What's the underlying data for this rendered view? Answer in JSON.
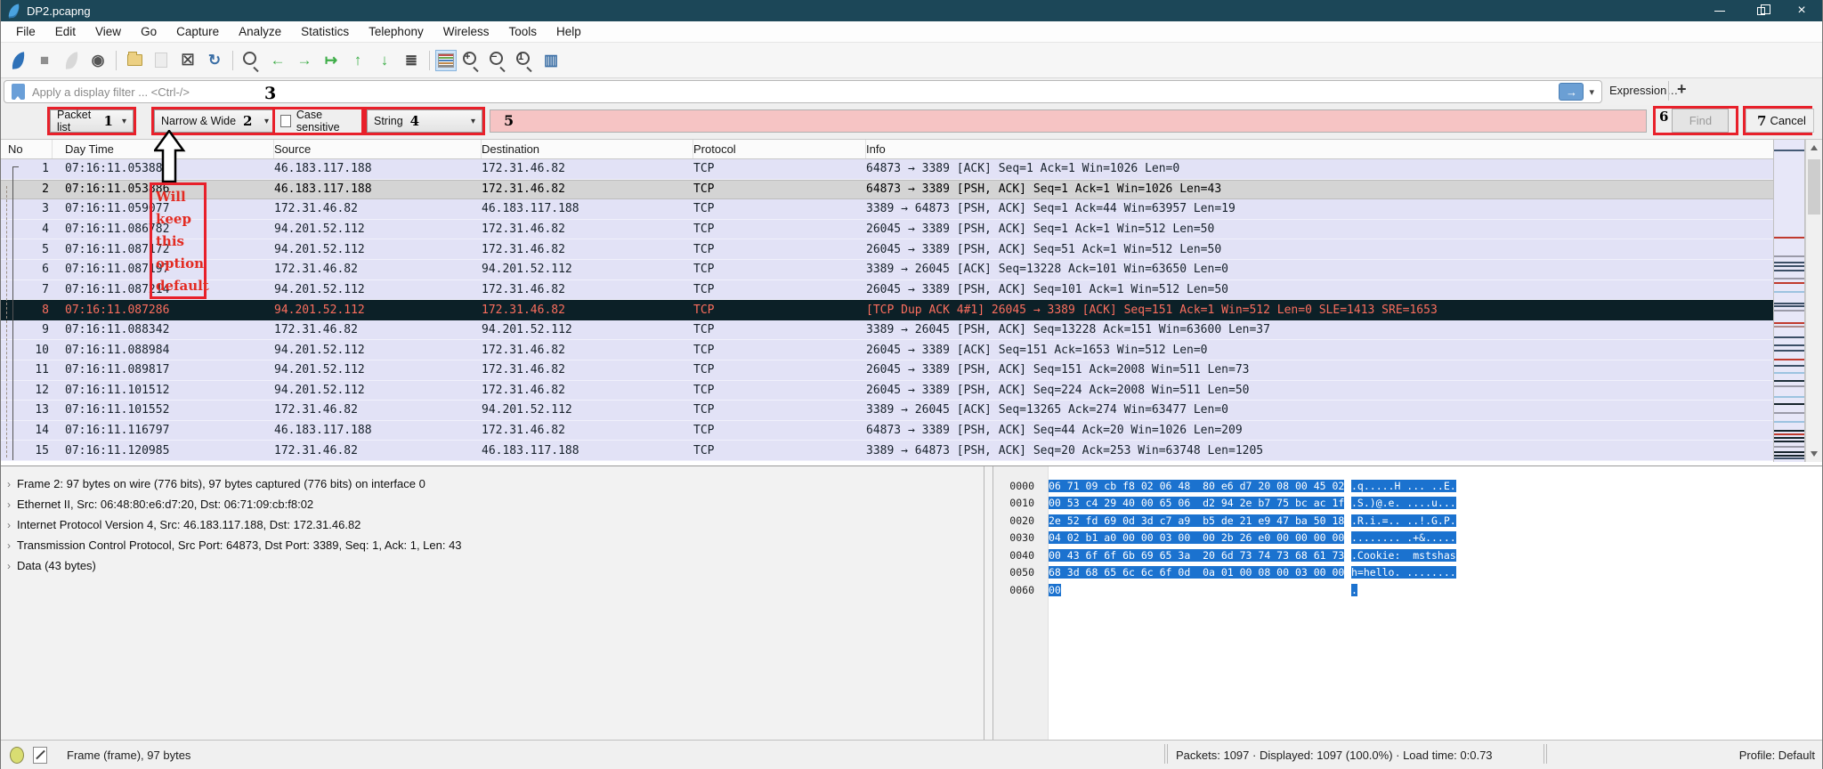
{
  "window": {
    "title": "DP2.pcapng"
  },
  "titlebar": {
    "close_glyph": "×"
  },
  "menu": {
    "items": [
      "File",
      "Edit",
      "View",
      "Go",
      "Capture",
      "Analyze",
      "Statistics",
      "Telephony",
      "Wireless",
      "Tools",
      "Help"
    ]
  },
  "toolbar": {
    "icons": [
      {
        "name": "start-capture",
        "cls": "fin",
        "color": "#2e71b8"
      },
      {
        "name": "stop-capture",
        "char": "■",
        "color": "#8f8f8f"
      },
      {
        "name": "restart-capture",
        "cls": "fin",
        "color": "#b0b0b0",
        "disabled": true
      },
      {
        "name": "capture-options",
        "char": "◉",
        "color": "#555555"
      },
      {
        "sep": true
      },
      {
        "name": "open-file",
        "cls": "folder"
      },
      {
        "name": "save-file",
        "cls": "doc",
        "disabled": true
      },
      {
        "name": "close-file",
        "char": "☒",
        "color": "#444444"
      },
      {
        "name": "reload-file",
        "char": "↻",
        "color": "#3a6ea5"
      },
      {
        "sep": true
      },
      {
        "name": "find-packet",
        "cls": "mag"
      },
      {
        "name": "go-back",
        "char": "←",
        "color": "#3fae49"
      },
      {
        "name": "go-forward",
        "char": "→",
        "color": "#3fae49"
      },
      {
        "name": "go-to-packet",
        "char": "↦",
        "color": "#3fae49"
      },
      {
        "name": "go-to-top",
        "char": "↑",
        "color": "#3fae49"
      },
      {
        "name": "go-to-bottom",
        "char": "↓",
        "color": "#3fae49"
      },
      {
        "name": "auto-scroll",
        "char": "≣",
        "color": "#444444"
      },
      {
        "sep": true
      },
      {
        "name": "colorize-packets",
        "cls": "colorize",
        "selected": true
      },
      {
        "name": "zoom-in",
        "cls": "mag",
        "char": "+"
      },
      {
        "name": "zoom-out",
        "cls": "mag",
        "char": "−"
      },
      {
        "name": "zoom-reset",
        "cls": "mag",
        "char": "1"
      },
      {
        "name": "resize-columns",
        "char": "▥",
        "color": "#3a6ea5"
      }
    ]
  },
  "filter_bar": {
    "placeholder": "Apply a display filter ... <Ctrl-/>",
    "apply_arrow": "→",
    "caret": "▾",
    "expression_label": "Expression…",
    "add_label": "+"
  },
  "find_bar": {
    "scope": "Packet list",
    "charset": "Narrow & Wide",
    "case_label": "Case sensitive",
    "type": "String",
    "search_value": "",
    "find_label": "Find",
    "cancel_label": "Cancel",
    "caret": "▾"
  },
  "annotations": {
    "numbers": [
      "1",
      "2",
      "3",
      "4",
      "5",
      "6",
      "7"
    ],
    "note_lines": [
      "Will",
      "keep",
      "this",
      "option",
      "default"
    ],
    "accent": "#e8202a"
  },
  "packet_list": {
    "columns": [
      "No",
      "Day Time",
      "Source",
      "Destination",
      "Protocol",
      "Info"
    ],
    "rows": [
      {
        "no": "1",
        "time": "07:16:11.053886",
        "src": "46.183.117.188",
        "dst": "172.31.46.82",
        "proto": "TCP",
        "info": "64873 → 3389 [ACK] Seq=1 Ack=1 Win=1026 Len=0",
        "state": "normal"
      },
      {
        "no": "2",
        "time": "07:16:11.053886",
        "src": "46.183.117.188",
        "dst": "172.31.46.82",
        "proto": "TCP",
        "info": "64873 → 3389 [PSH, ACK] Seq=1 Ack=1 Win=1026 Len=43",
        "state": "selected"
      },
      {
        "no": "3",
        "time": "07:16:11.059077",
        "src": "172.31.46.82",
        "dst": "46.183.117.188",
        "proto": "TCP",
        "info": "3389 → 64873 [PSH, ACK] Seq=1 Ack=44 Win=63957 Len=19",
        "state": "normal"
      },
      {
        "no": "4",
        "time": "07:16:11.086782",
        "src": "94.201.52.112",
        "dst": "172.31.46.82",
        "proto": "TCP",
        "info": "26045 → 3389 [PSH, ACK] Seq=1 Ack=1 Win=512 Len=50",
        "state": "normal"
      },
      {
        "no": "5",
        "time": "07:16:11.087172",
        "src": "94.201.52.112",
        "dst": "172.31.46.82",
        "proto": "TCP",
        "info": "26045 → 3389 [PSH, ACK] Seq=51 Ack=1 Win=512 Len=50",
        "state": "normal"
      },
      {
        "no": "6",
        "time": "07:16:11.087197",
        "src": "172.31.46.82",
        "dst": "94.201.52.112",
        "proto": "TCP",
        "info": "3389 → 26045 [ACK] Seq=13228 Ack=101 Win=63650 Len=0",
        "state": "normal"
      },
      {
        "no": "7",
        "time": "07:16:11.087214",
        "src": "94.201.52.112",
        "dst": "172.31.46.82",
        "proto": "TCP",
        "info": "26045 → 3389 [PSH, ACK] Seq=101 Ack=1 Win=512 Len=50",
        "state": "normal"
      },
      {
        "no": "8",
        "time": "07:16:11.087286",
        "src": "94.201.52.112",
        "dst": "172.31.46.82",
        "proto": "TCP",
        "info": "[TCP Dup ACK 4#1] 26045 → 3389 [ACK] Seq=151 Ack=1 Win=512 Len=0 SLE=1413 SRE=1653",
        "state": "bad"
      },
      {
        "no": "9",
        "time": "07:16:11.088342",
        "src": "172.31.46.82",
        "dst": "94.201.52.112",
        "proto": "TCP",
        "info": "3389 → 26045 [PSH, ACK] Seq=13228 Ack=151 Win=63600 Len=37",
        "state": "normal"
      },
      {
        "no": "10",
        "time": "07:16:11.088984",
        "src": "94.201.52.112",
        "dst": "172.31.46.82",
        "proto": "TCP",
        "info": "26045 → 3389 [ACK] Seq=151 Ack=1653 Win=512 Len=0",
        "state": "normal"
      },
      {
        "no": "11",
        "time": "07:16:11.089817",
        "src": "94.201.52.112",
        "dst": "172.31.46.82",
        "proto": "TCP",
        "info": "26045 → 3389 [PSH, ACK] Seq=151 Ack=2008 Win=511 Len=73",
        "state": "normal"
      },
      {
        "no": "12",
        "time": "07:16:11.101512",
        "src": "94.201.52.112",
        "dst": "172.31.46.82",
        "proto": "TCP",
        "info": "26045 → 3389 [PSH, ACK] Seq=224 Ack=2008 Win=511 Len=50",
        "state": "normal"
      },
      {
        "no": "13",
        "time": "07:16:11.101552",
        "src": "172.31.46.82",
        "dst": "94.201.52.112",
        "proto": "TCP",
        "info": "3389 → 26045 [ACK] Seq=13265 Ack=274 Win=63477 Len=0",
        "state": "normal"
      },
      {
        "no": "14",
        "time": "07:16:11.116797",
        "src": "46.183.117.188",
        "dst": "172.31.46.82",
        "proto": "TCP",
        "info": "64873 → 3389 [PSH, ACK] Seq=44 Ack=20 Win=1026 Len=209",
        "state": "normal"
      },
      {
        "no": "15",
        "time": "07:16:11.120985",
        "src": "172.31.46.82",
        "dst": "46.183.117.188",
        "proto": "TCP",
        "info": "3389 → 64873 [PSH, ACK] Seq=20 Ack=253 Win=63748 Len=1205",
        "state": "normal"
      }
    ]
  },
  "details": {
    "expander": "›",
    "lines": [
      "Frame 2: 97 bytes on wire (776 bits), 97 bytes captured (776 bits) on interface 0",
      "Ethernet II, Src: 06:48:80:e6:d7:20, Dst: 06:71:09:cb:f8:02",
      "Internet Protocol Version 4, Src: 46.183.117.188, Dst: 172.31.46.82",
      "Transmission Control Protocol, Src Port: 64873, Dst Port: 3389, Seq: 1, Ack: 1, Len: 43",
      "Data (43 bytes)"
    ]
  },
  "bytes": {
    "rows": [
      {
        "offset": "0000",
        "hex": "06 71 09 cb f8 02 06 48  80 e6 d7 20 08 00 45 02",
        "ascii": ".q.....H ... ..E."
      },
      {
        "offset": "0010",
        "hex": "00 53 c4 29 40 00 65 06  d2 94 2e b7 75 bc ac 1f",
        "ascii": ".S.)@.e. ....u..."
      },
      {
        "offset": "0020",
        "hex": "2e 52 fd 69 0d 3d c7 a9  b5 de 21 e9 47 ba 50 18",
        "ascii": ".R.i.=.. ..!.G.P."
      },
      {
        "offset": "0030",
        "hex": "04 02 b1 a0 00 00 03 00  00 2b 26 e0 00 00 00 00",
        "ascii": "........ .+&....."
      },
      {
        "offset": "0040",
        "hex": "00 43 6f 6f 6b 69 65 3a  20 6d 73 74 73 68 61 73",
        "ascii": ".Cookie:  mstshas"
      },
      {
        "offset": "0050",
        "hex": "68 3d 68 65 6c 6c 6f 0d  0a 01 00 08 00 03 00 00",
        "ascii": "h=hello. ........"
      },
      {
        "offset": "0060",
        "hex": "00",
        "ascii": "."
      }
    ]
  },
  "status_bar": {
    "left": "Frame (frame), 97 bytes",
    "packets": "Packets: 1097 · Displayed: 1097 (100.0%) ·  Load time: 0:0.73",
    "profile": "Profile: Default"
  },
  "minimap": {
    "stripes": [
      {
        "t": 11,
        "c": "#445a75"
      },
      {
        "t": 109,
        "c": "#c03a2e"
      },
      {
        "t": 130,
        "c": "#9a9aa8"
      },
      {
        "t": 137,
        "c": "#3c4f66"
      },
      {
        "t": 141,
        "c": "#3c4f66"
      },
      {
        "t": 146,
        "c": "#3c4f66"
      },
      {
        "t": 155,
        "c": "#9a9aa8"
      },
      {
        "t": 160,
        "c": "#c03a2e"
      },
      {
        "t": 170,
        "c": "#9cc3e0"
      },
      {
        "t": 183,
        "c": "#3c4f66"
      },
      {
        "t": 186,
        "c": "#3c4f66"
      },
      {
        "t": 191,
        "c": "#9a9aa8"
      },
      {
        "t": 205,
        "c": "#c03a2e"
      },
      {
        "t": 209,
        "c": "#b08a8a"
      },
      {
        "t": 221,
        "c": "#3c4f66"
      },
      {
        "t": 230,
        "c": "#3c4f66"
      },
      {
        "t": 236,
        "c": "#3c4f66"
      },
      {
        "t": 246,
        "c": "#c03a2e"
      },
      {
        "t": 253,
        "c": "#3c4f66"
      },
      {
        "t": 261,
        "c": "#9cc3e0"
      },
      {
        "t": 270,
        "c": "#1d2e38"
      },
      {
        "t": 276,
        "c": "#9a9aa8"
      },
      {
        "t": 288,
        "c": "#9cc3e0"
      },
      {
        "t": 296,
        "c": "#16242c"
      },
      {
        "t": 306,
        "c": "#9a9aa8"
      },
      {
        "t": 316,
        "c": "#9cc3e0"
      },
      {
        "t": 326,
        "c": "#16242c"
      },
      {
        "t": 330,
        "c": "#c03a2e"
      },
      {
        "t": 334,
        "c": "#16242c"
      },
      {
        "t": 338,
        "c": "#16242c"
      },
      {
        "t": 344,
        "c": "#9a9aa8"
      },
      {
        "t": 350,
        "c": "#16242c"
      },
      {
        "t": 354,
        "c": "#16242c"
      },
      {
        "t": 357,
        "c": "#3c4f66"
      }
    ]
  }
}
